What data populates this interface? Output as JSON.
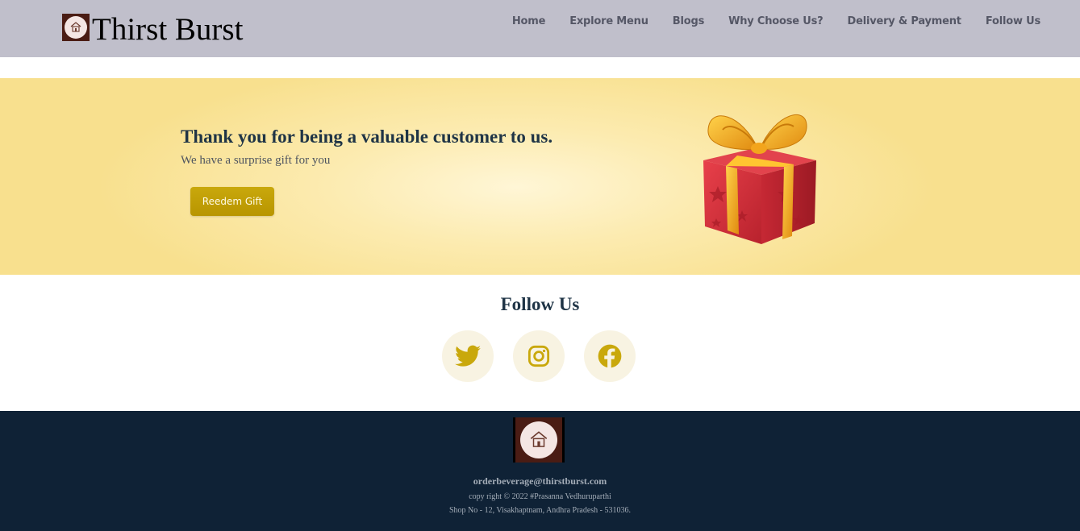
{
  "brand": {
    "name": "Thirst Burst"
  },
  "nav": {
    "items": [
      {
        "label": "Home"
      },
      {
        "label": "Explore Menu"
      },
      {
        "label": "Blogs"
      },
      {
        "label": "Why Choose Us?"
      },
      {
        "label": "Delivery & Payment"
      },
      {
        "label": "Follow Us"
      }
    ]
  },
  "banner": {
    "title": "Thank you for being a valuable customer to us.",
    "subtitle": "We have a surprise gift for you",
    "button_label": "Reedem Gift"
  },
  "follow": {
    "title": "Follow Us",
    "icons": [
      "twitter-icon",
      "instagram-icon",
      "facebook-icon"
    ]
  },
  "footer": {
    "email": "orderbeverage@thirstburst.com",
    "copyright": "copy right © 2022 #Prasanna Vedhuruparthi",
    "address": "Shop No - 12, Visakhaptnam, Andhra Pradesh - 531036."
  },
  "colors": {
    "navbar": "#c0bfcb",
    "accent": "#c9a80c",
    "heading": "#1f3446",
    "footer": "#0f2236"
  }
}
